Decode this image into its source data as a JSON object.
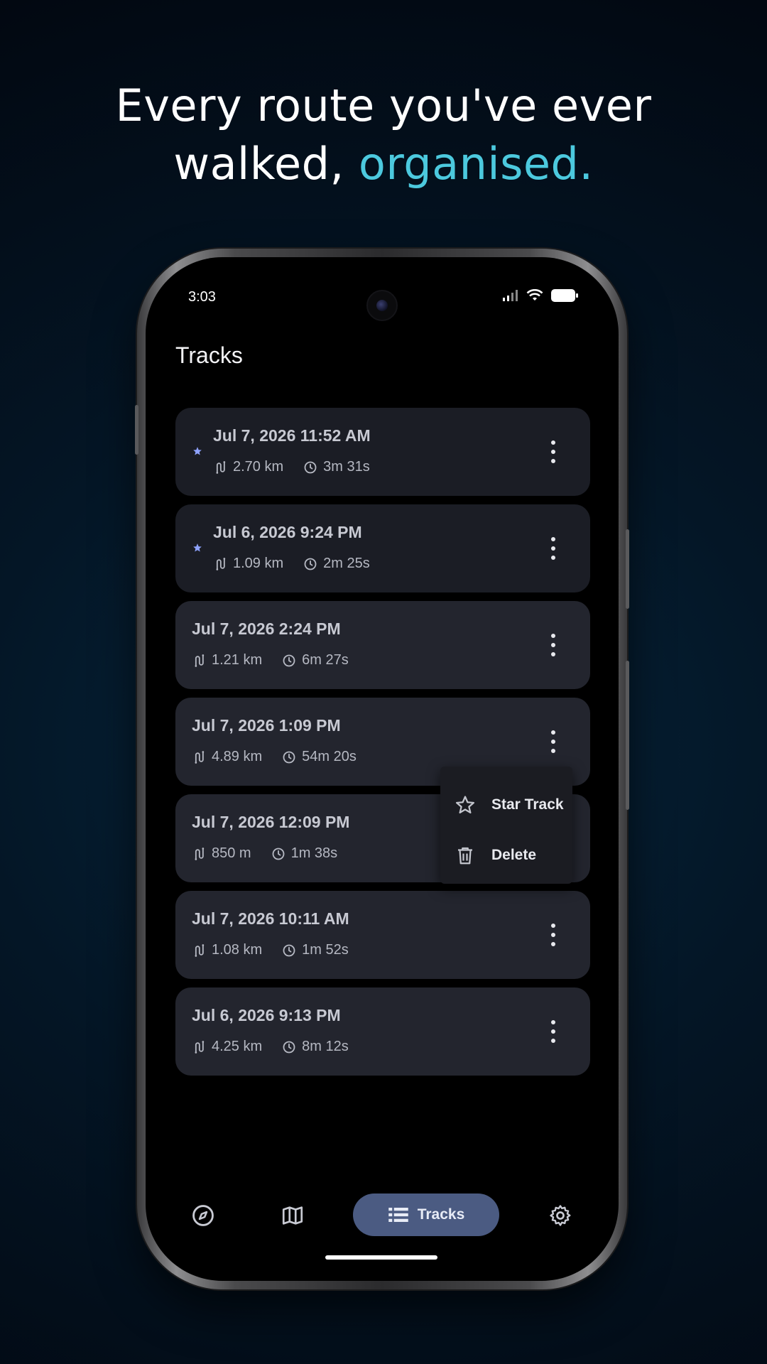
{
  "headline": {
    "line1": "Every route you've ever",
    "line2_prefix": "walked, ",
    "line2_accent": "organised."
  },
  "status_bar": {
    "time": "3:03",
    "icons": [
      "signal-icon",
      "wifi-icon",
      "battery-icon"
    ]
  },
  "screen": {
    "title": "Tracks"
  },
  "tracks": [
    {
      "date": "Jul 7, 2026 11:52 AM",
      "distance": "2.70 km",
      "duration": "3m 31s",
      "starred": true
    },
    {
      "date": "Jul 6, 2026 9:24 PM",
      "distance": "1.09 km",
      "duration": "2m 25s",
      "starred": true
    },
    {
      "date": "Jul 7, 2026 2:24 PM",
      "distance": "1.21 km",
      "duration": "6m 27s",
      "starred": false
    },
    {
      "date": "Jul 7, 2026 1:09 PM",
      "distance": "4.89 km",
      "duration": "54m 20s",
      "starred": false
    },
    {
      "date": "Jul 7, 2026 12:09 PM",
      "distance": "850 m",
      "duration": "1m 38s",
      "starred": false
    },
    {
      "date": "Jul 7, 2026 10:11 AM",
      "distance": "1.08 km",
      "duration": "1m 52s",
      "starred": false
    },
    {
      "date": "Jul 6, 2026 9:13 PM",
      "distance": "4.25 km",
      "duration": "8m 12s",
      "starred": false
    }
  ],
  "context_menu": {
    "items": [
      {
        "label": "Star Track",
        "icon": "star-outline-icon"
      },
      {
        "label": "Delete",
        "icon": "trash-icon"
      }
    ]
  },
  "bottom_nav": {
    "items": [
      {
        "icon": "compass-icon"
      },
      {
        "icon": "map-icon"
      },
      {
        "icon": "list-icon",
        "label": "Tracks",
        "active": true
      },
      {
        "icon": "gear-icon"
      }
    ]
  },
  "colors": {
    "accent": "#4cc9de",
    "card": "#23252e",
    "card_starred": "#1b1d25",
    "nav_active": "#4b5b82",
    "star": "#8fa3ff"
  }
}
